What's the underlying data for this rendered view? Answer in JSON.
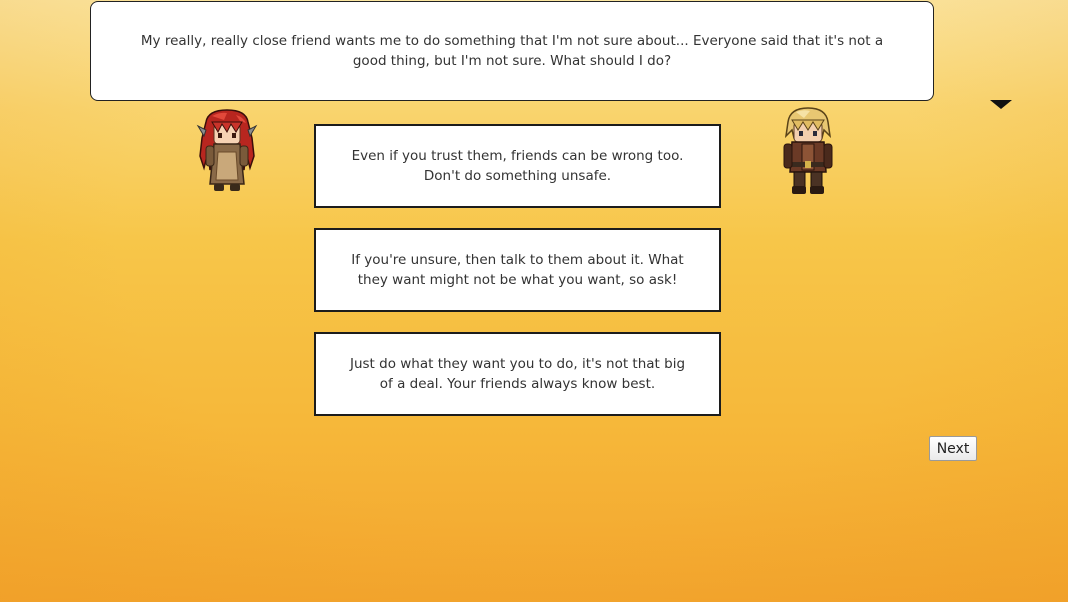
{
  "dialog": {
    "text": "My really, really close friend wants me to do something that I'm not sure about... Everyone said that it's not a good thing, but I'm not sure. What should I do?"
  },
  "choices": [
    {
      "text": "Even if you trust them, friends can be wrong too. Don't do something unsafe."
    },
    {
      "text": "If you're unsure, then talk to them about it. What they want might not be what you want, so ask!"
    },
    {
      "text": "Just do what they want you to do, it's not that big of a deal. Your friends always know best."
    }
  ],
  "controls": {
    "next_label": "Next"
  },
  "characters": {
    "left": {
      "hair_color": "#c9332a",
      "dress_color": "#8a6a48"
    },
    "right": {
      "hair_color": "#e8c772",
      "outfit_color": "#6b3a26"
    }
  }
}
